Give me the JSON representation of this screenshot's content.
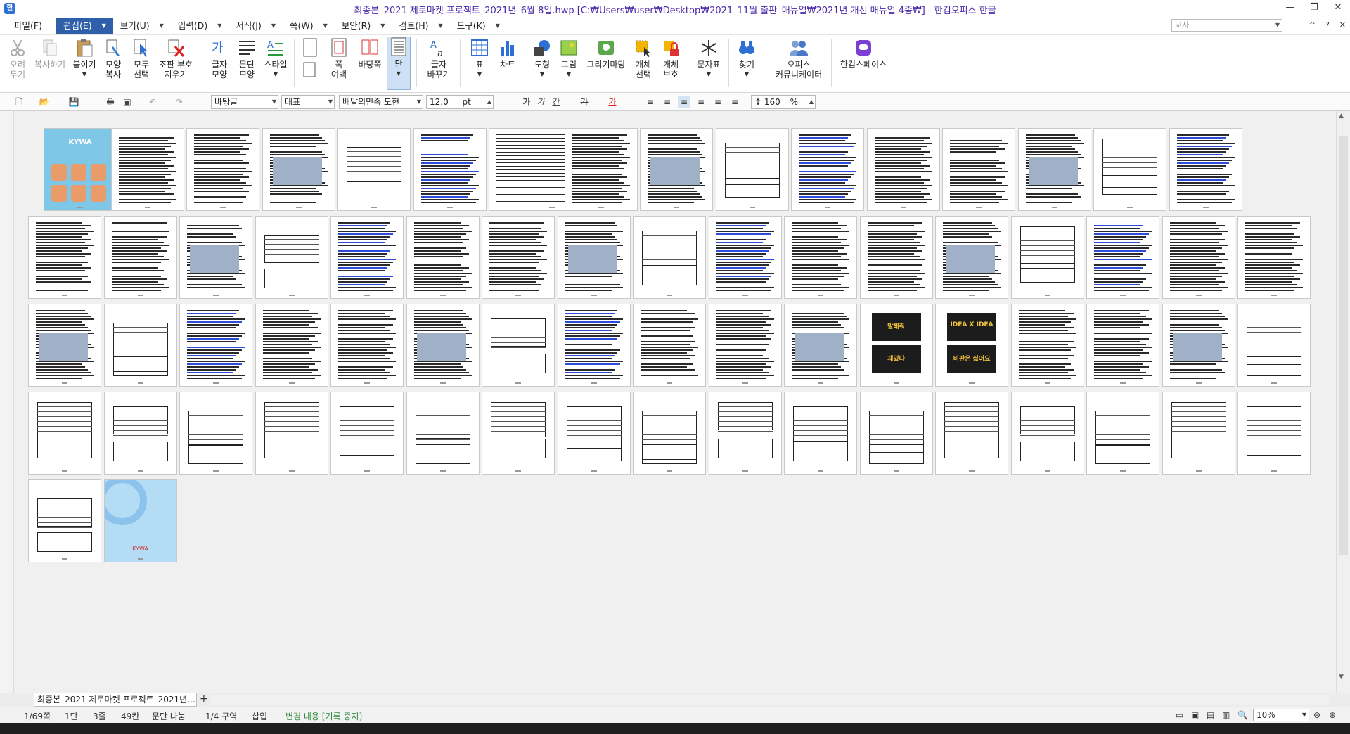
{
  "window": {
    "title": "최종본_2021 제로마켓 프로젝트_2021년_6월 8일.hwp [C:₩Users₩user₩Desktop₩2021_11월 출판_매뉴얼₩2021년 개선 매뉴얼 4종₩] - 한컴오피스 한글",
    "app_icon": "hwp-icon",
    "controls": [
      "—",
      "❐",
      "✕"
    ]
  },
  "menu": {
    "items": [
      {
        "label": "파일(F)"
      },
      {
        "label": "편집(E)",
        "active": true
      },
      {
        "label": "보기(U)"
      },
      {
        "label": "입력(D)"
      },
      {
        "label": "서식(J)"
      },
      {
        "label": "쪽(W)"
      },
      {
        "label": "보안(R)"
      },
      {
        "label": "검토(H)"
      },
      {
        "label": "도구(K)"
      }
    ],
    "search_placeholder": "교사",
    "right_icons": [
      "^",
      "?",
      "✕"
    ]
  },
  "ribbon": {
    "cut": "오려\n두기",
    "copy": "복사하기",
    "paste": "붙이기",
    "format_copy": "모양\n복사",
    "select_all": "모두\n선택",
    "delete_code": "조판 부호\n지우기",
    "char_shape": "글자\n모양",
    "para_shape": "문단\n모양",
    "style": "스타일",
    "page_margin": "쪽\n여백",
    "background_page": "바탕쪽",
    "column": "단",
    "char_replace": "글자\n바꾸기",
    "table": "표",
    "chart": "차트",
    "shape": "도형",
    "picture": "그림",
    "drawing_madang": "그리기마당",
    "object_select": "개체\n선택",
    "object_protect": "개체\n보호",
    "symbol": "문자표",
    "find": "찾기",
    "office_communicator": "오피스\n커뮤니케이터",
    "hancom_space": "한컴스페이스"
  },
  "toolbar2": {
    "style_combo": "바탕글",
    "lang_combo": "대표",
    "font_combo": "배달의민족 도현",
    "font_size": "12.0",
    "font_unit": "pt",
    "bold": "가",
    "italic": "가",
    "underline": "간",
    "strike": "가",
    "color": "가",
    "line_spacing": "160",
    "percent": "%"
  },
  "document": {
    "tab_label": "최종본_2021 제로마켓 프로젝트_2021년...",
    "tab_add": "+"
  },
  "status": {
    "page": "1/69쪽",
    "column": "1단",
    "line": "3줄",
    "col_pos": "49칸",
    "para_break": "문단 나눔",
    "section": "1/4 구역",
    "insert_mode": "삽입",
    "track_changes": "변경 내용 [기록 중지]",
    "zoom": "10%"
  },
  "thumbnails": {
    "cover_text": "KYWA",
    "dark_card_1a": "말해줘",
    "dark_card_1b": "재밌다",
    "dark_card_2a": "IDEA X IDEA",
    "dark_card_2b": "비판은 싫어요",
    "back_cover_text": "KYWA"
  }
}
